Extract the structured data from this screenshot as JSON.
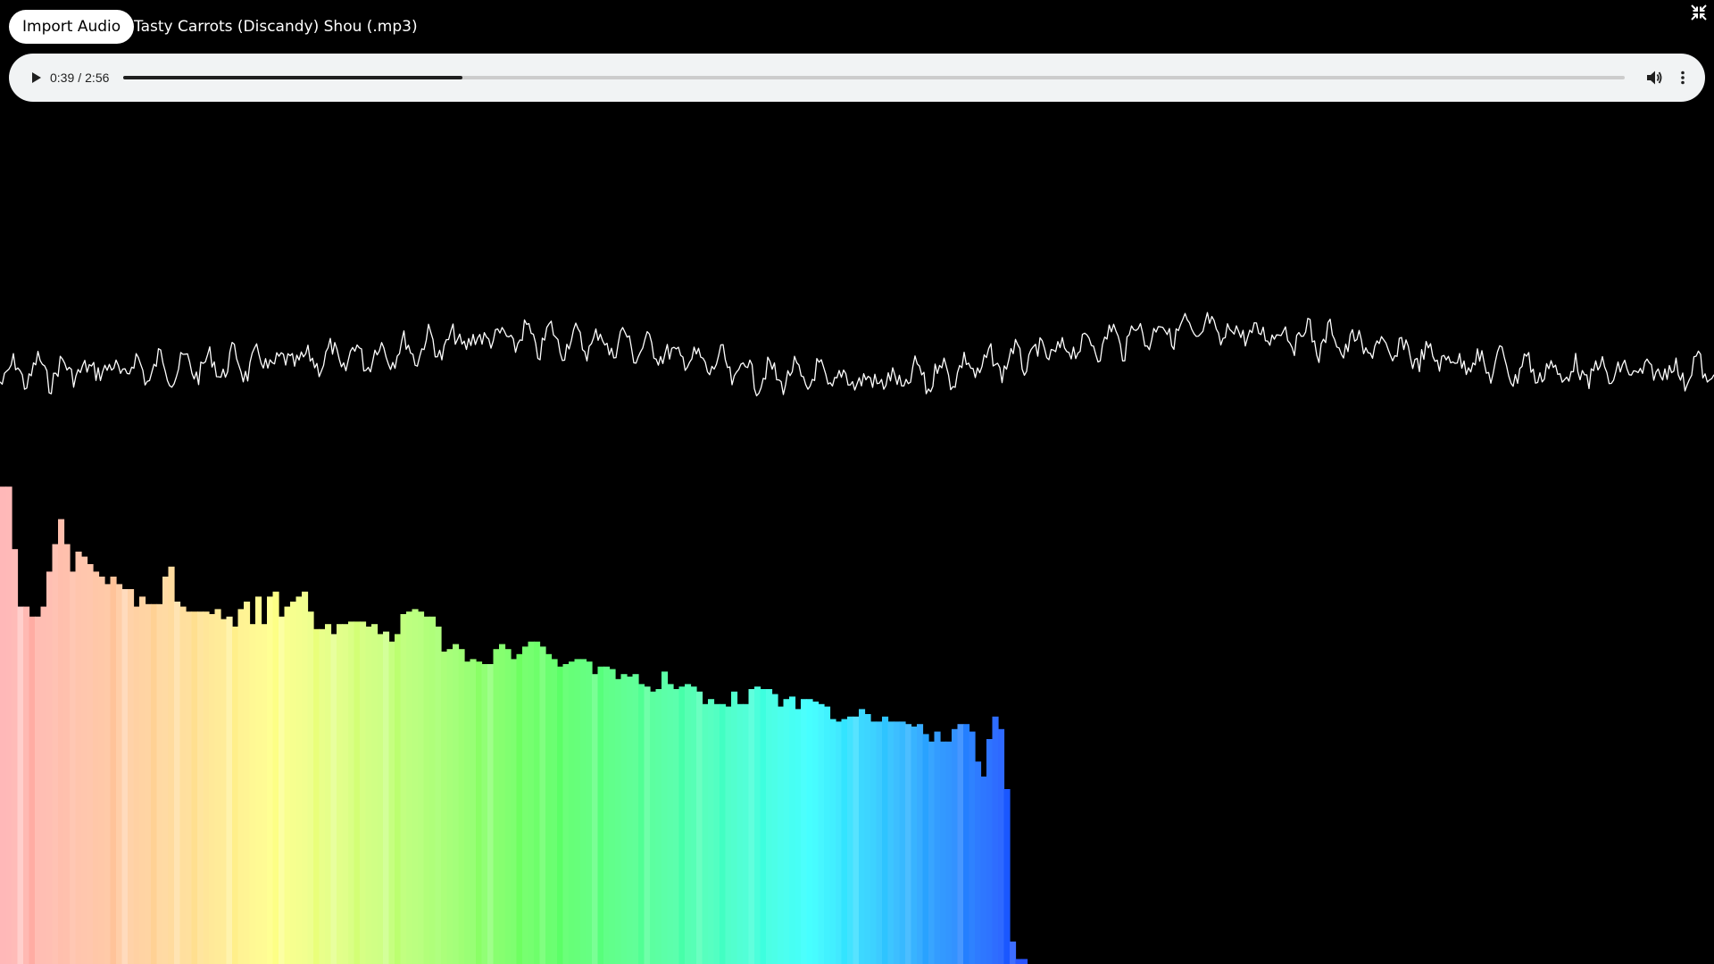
{
  "toolbar": {
    "import_label": "Import Audio",
    "file_name": "Tasty Carrots (Discandy) Shou (.mp3)"
  },
  "player": {
    "current_time": "0:39",
    "separator": "/",
    "duration": "2:56",
    "progress_fraction": 0.226
  },
  "visualizer": {
    "background_color": "#000000",
    "waveform_color": "#ffffff",
    "spectrum_levels": [
      95.5,
      95.5,
      83,
      71.5,
      71.5,
      69.5,
      69.5,
      71.5,
      78.5,
      84,
      89,
      84,
      78.5,
      82.5,
      81.5,
      80,
      78.5,
      77.5,
      76,
      77.5,
      76,
      75,
      75,
      71.5,
      73.5,
      72,
      72,
      72,
      77.5,
      79.5,
      72.5,
      71.5,
      70.5,
      70.5,
      70.5,
      70.5,
      70,
      71,
      69,
      69.5,
      67.5,
      71,
      72.5,
      68,
      73.5,
      68,
      73.5,
      74.5,
      69.5,
      71.5,
      72.5,
      73.5,
      74.5,
      70.5,
      67,
      67,
      68,
      66,
      68,
      68,
      68.5,
      68.5,
      68.5,
      67.5,
      68,
      66,
      66.5,
      64.5,
      66,
      70,
      70.5,
      71,
      70.5,
      69.5,
      69.5,
      67.5,
      62.5,
      63,
      64,
      63,
      60.5,
      61,
      60.5,
      60,
      60,
      63,
      64,
      63,
      61,
      62,
      63.5,
      64.5,
      64.5,
      63.5,
      62,
      61,
      59.5,
      60,
      60.5,
      61,
      61,
      60.5,
      58,
      59.5,
      59.5,
      59,
      57,
      58,
      57.5,
      58,
      56,
      55.5,
      54.5,
      55,
      58.5,
      56,
      55,
      55.5,
      56,
      55.5,
      54.5,
      52,
      53,
      52,
      52,
      51.5,
      54.5,
      52,
      52,
      55,
      55.5,
      55,
      55,
      54,
      51.5,
      53,
      53.5,
      51,
      53,
      53,
      52.5,
      52,
      51.5,
      49,
      48.5,
      49,
      49.5,
      49.5,
      51,
      50,
      48.5,
      48.5,
      49.5,
      48.5,
      48.5,
      48.5,
      48,
      47.5,
      48,
      46,
      44.5,
      46.5,
      44.5,
      44.5,
      47,
      48,
      48,
      46.5,
      40.5,
      37.5,
      45,
      49.5,
      47,
      35,
      4.5,
      1,
      1
    ]
  }
}
